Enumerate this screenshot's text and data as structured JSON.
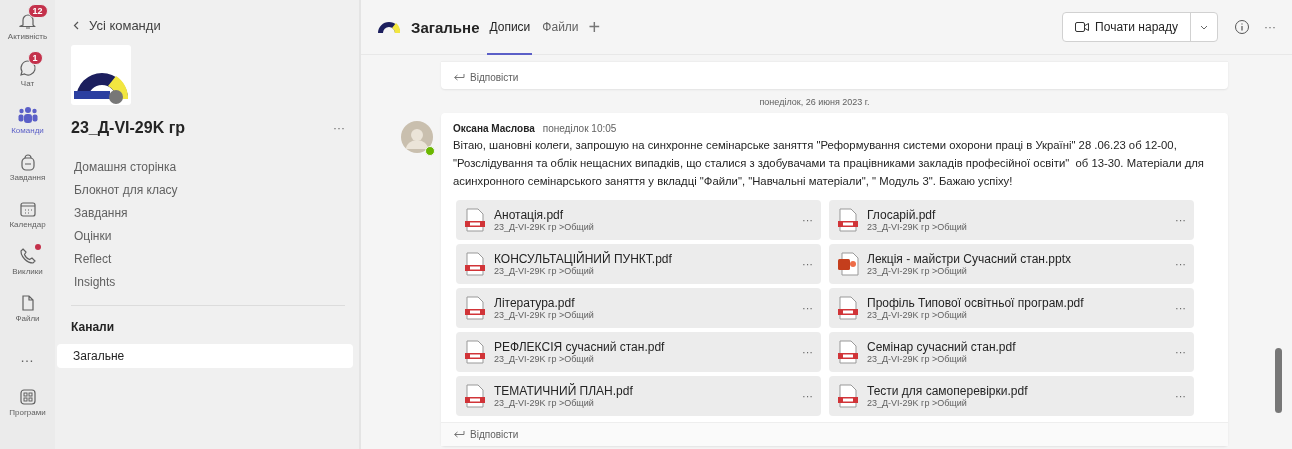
{
  "rail": [
    {
      "label": "Активність",
      "kind": "bell",
      "badge": "12",
      "dot": false,
      "selected": false
    },
    {
      "label": "Чат",
      "kind": "chat",
      "badge": "1",
      "dot": false,
      "selected": false
    },
    {
      "label": "Команди",
      "kind": "teams",
      "dot": false,
      "selected": true
    },
    {
      "label": "Завдання",
      "kind": "bag",
      "dot": false,
      "selected": false
    },
    {
      "label": "Календар",
      "kind": "calendar",
      "dot": false,
      "selected": false
    },
    {
      "label": "Виклики",
      "kind": "phone",
      "dot": true,
      "selected": false
    },
    {
      "label": "Файли",
      "kind": "file",
      "dot": false,
      "selected": false
    },
    {
      "label": "…",
      "kind": "more",
      "dot": false,
      "selected": false
    },
    {
      "label": "Програми",
      "kind": "apps",
      "dot": false,
      "selected": false
    }
  ],
  "sidebar": {
    "back": "Усі команди",
    "team_name": "23_Д-VI-29K гр",
    "more": "···",
    "items": [
      "Домашня сторінка",
      "Блокнот для класу",
      "Завдання",
      "Оцінки",
      "Reflect",
      "Insights"
    ],
    "channels_title": "Канали",
    "channels": [
      {
        "label": "Загальне",
        "selected": true
      }
    ]
  },
  "header": {
    "channel": "Загальне",
    "tabs": [
      {
        "label": "Дописи",
        "selected": true
      },
      {
        "label": "Файли",
        "selected": false
      }
    ],
    "add": "+",
    "meet_button": "Почати нараду",
    "more": "···"
  },
  "feed": {
    "prev_reply": "Відповісти",
    "date_divider": "понеділок, 26 июня 2023 г.",
    "message": {
      "author": "Оксана Маслова",
      "time": "понеділок 10:05",
      "online": true,
      "text": "Вітаю, шановні колеги, запрошую на синхронне семінарське заняття \"Реформування системи охорони праці в Україні\" 28 .06.23 об 12-00, \"Розслідування та облік нещасних випадків, що сталися з здобувачами та працівниками закладів професійної освіти\"  об 13-30. Матеріали для асинхронного семінарського заняття у вкладці \"Файли\", \"Навчальні матеріали\", \" Модуль 3\". Бажаю успіху!",
      "files": [
        {
          "name": "Анотація.pdf",
          "path": "23_Д-VI-29K гр >Общий",
          "kind": "pdf"
        },
        {
          "name": "Глосарій.pdf",
          "path": "23_Д-VI-29K гр >Общий",
          "kind": "pdf"
        },
        {
          "name": "КОНСУЛЬТАЦІЙНИЙ ПУНКТ.pdf",
          "path": "23_Д-VI-29K гр >Общий",
          "kind": "pdf"
        },
        {
          "name": "Лекція - майстри Сучасний стан.pptx",
          "path": "23_Д-VI-29K гр >Общий",
          "kind": "pptx"
        },
        {
          "name": "Література.pdf",
          "path": "23_Д-VI-29K гр >Общий",
          "kind": "pdf"
        },
        {
          "name": "Профіль Типової освітньої програм.pdf",
          "path": "23_Д-VI-29K гр >Общий",
          "kind": "pdf"
        },
        {
          "name": "РЕФЛЕКСІЯ сучасний стан.pdf",
          "path": "23_Д-VI-29K гр >Общий",
          "kind": "pdf"
        },
        {
          "name": "Семінар сучасний стан.pdf",
          "path": "23_Д-VI-29K гр >Общий",
          "kind": "pdf"
        },
        {
          "name": "ТЕМАТИЧНИЙ ПЛАН.pdf",
          "path": "23_Д-VI-29K гр >Общий",
          "kind": "pdf"
        },
        {
          "name": "Тести для самоперевірки.pdf",
          "path": "23_Д-VI-29K гр >Общий",
          "kind": "pdf"
        }
      ],
      "file_more": "···",
      "reply": "Відповісти"
    }
  }
}
